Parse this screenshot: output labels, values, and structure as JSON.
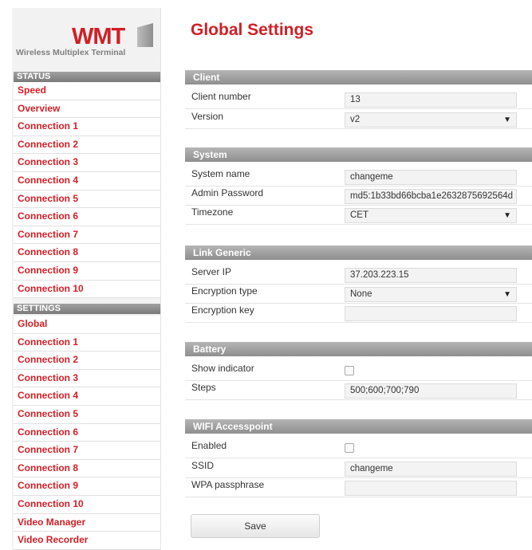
{
  "logo": {
    "brand": "WMT",
    "tagline": "Wireless Multiplex Terminal"
  },
  "sidebar": {
    "status_header": "STATUS",
    "status_items": [
      "Speed",
      "Overview",
      "Connection 1",
      "Connection 2",
      "Connection 3",
      "Connection 4",
      "Connection 5",
      "Connection 6",
      "Connection 7",
      "Connection 8",
      "Connection 9",
      "Connection 10"
    ],
    "settings_header": "SETTINGS",
    "settings_items": [
      "Global",
      "Connection 1",
      "Connection 2",
      "Connection 3",
      "Connection 4",
      "Connection 5",
      "Connection 6",
      "Connection 7",
      "Connection 8",
      "Connection 9",
      "Connection 10",
      "Video Manager",
      "Video Recorder"
    ]
  },
  "main": {
    "title": "Global Settings",
    "client": {
      "header": "Client",
      "client_number_label": "Client number",
      "client_number": "13",
      "version_label": "Version",
      "version": "v2"
    },
    "system": {
      "header": "System",
      "system_name_label": "System name",
      "system_name": "changeme",
      "admin_password_label": "Admin Password",
      "admin_password": "md5:1b33bd66bcba1e2632875692564d",
      "timezone_label": "Timezone",
      "timezone": "CET"
    },
    "link_generic": {
      "header": "Link Generic",
      "server_ip_label": "Server IP",
      "server_ip": "37.203.223.15",
      "encryption_type_label": "Encryption type",
      "encryption_type": "None",
      "encryption_key_label": "Encryption key",
      "encryption_key": ""
    },
    "battery": {
      "header": "Battery",
      "show_indicator_label": "Show indicator",
      "show_indicator": false,
      "steps_label": "Steps",
      "steps": "500;600;700;790"
    },
    "wifi": {
      "header": "WIFI Accesspoint",
      "enabled_label": "Enabled",
      "enabled": false,
      "ssid_label": "SSID",
      "ssid": "changeme",
      "wpa_label": "WPA passphrase",
      "wpa_passphrase": ""
    },
    "save_label": "Save"
  },
  "colors": {
    "accent": "#d11f26",
    "header_bg": "#8e8e8e",
    "sidebar_bg": "#f2f2f2"
  }
}
